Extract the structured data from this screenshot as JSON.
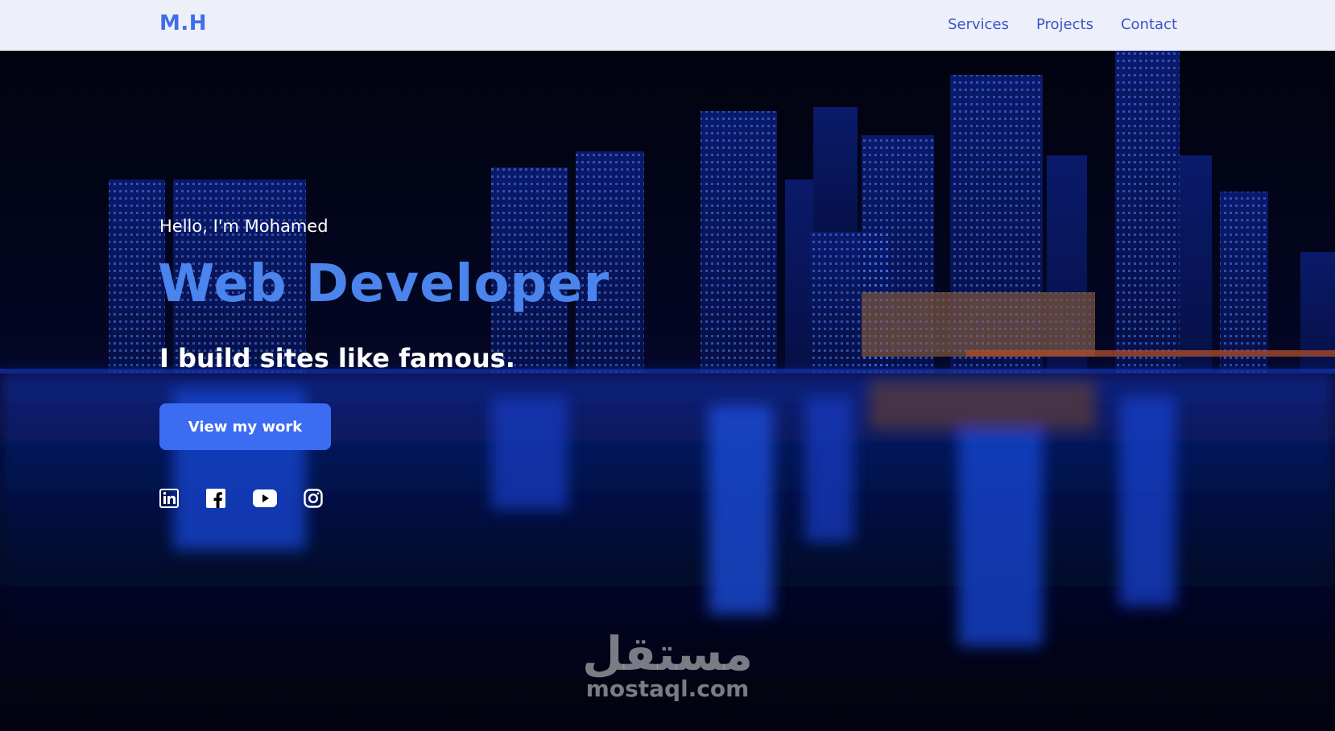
{
  "nav": {
    "logo": "M.H",
    "links": [
      "Services",
      "Projects",
      "Contact"
    ]
  },
  "hero": {
    "greeting": "Hello, I'm Mohamed",
    "title": "Web Developer",
    "tagline": "I build sites like famous.",
    "cta_label": "View my work",
    "socials": [
      "linkedin-icon",
      "facebook-icon",
      "youtube-icon",
      "instagram-icon"
    ]
  },
  "watermark": {
    "arabic": "مستقل",
    "latin": "mostaql.com"
  },
  "colors": {
    "accent": "#3c6cf2",
    "title_blue": "#4a84ec",
    "nav_bg": "#eef0f9",
    "nav_text": "#3a55c9"
  }
}
